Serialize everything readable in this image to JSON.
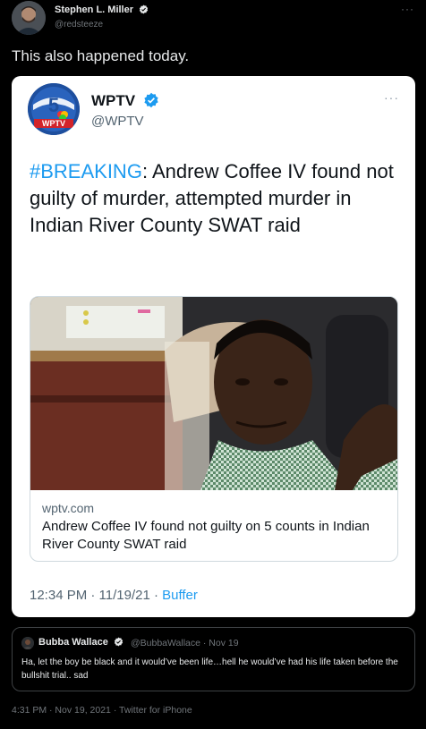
{
  "author": {
    "name": "Stephen L. Miller",
    "handle": "@redsteeze"
  },
  "tweet_text": "This also happened today.",
  "embedded": {
    "name": "WPTV",
    "handle": "@WPTV",
    "hashtag": "#BREAKING",
    "body": ": Andrew Coffee IV found not guilty of murder, attempted murder in Indian River County SWAT raid",
    "link": {
      "domain": "wptv.com",
      "title": "Andrew Coffee IV found not guilty on 5 counts in Indian River County SWAT raid"
    },
    "time": "12:34 PM · 11/19/21 · ",
    "source": "Buffer",
    "logo_text": "WPTV",
    "logo_number": "5"
  },
  "quote": {
    "name": "Bubba Wallace",
    "handle": "@BubbaWallace · Nov 19",
    "text": "Ha, let the boy be black and it would’ve been life…hell he would’ve had his life taken before the bullshit trial.. sad"
  },
  "footer": "4:31 PM · Nov 19, 2021 · Twitter for iPhone",
  "icons": {
    "verified": "verified-badge-icon",
    "more": "more-icon"
  },
  "colors": {
    "background": "#000000",
    "accent": "#1d9bf0",
    "card": "#ffffff",
    "muted": "#71767b"
  }
}
